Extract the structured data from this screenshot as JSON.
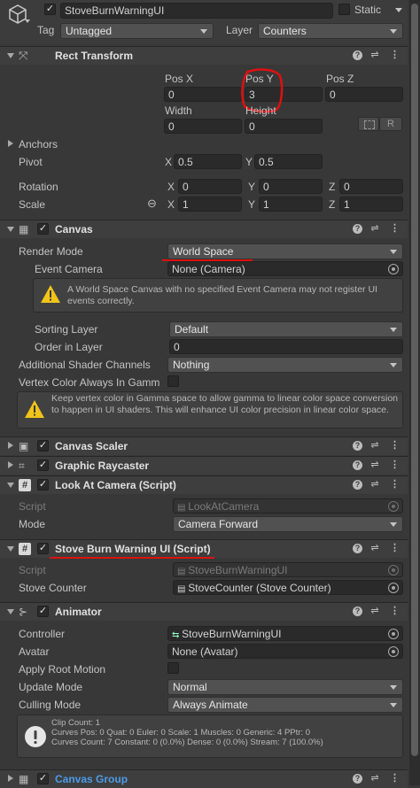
{
  "gameobject": {
    "name": "StoveBurnWarningUI",
    "static_label": "Static",
    "tag_label": "Tag",
    "tag_value": "Untagged",
    "layer_label": "Layer",
    "layer_value": "Counters"
  },
  "rect_transform": {
    "title": "Rect Transform",
    "pos_x_label": "Pos X",
    "pos_x": "0",
    "pos_y_label": "Pos Y",
    "pos_y": "3",
    "pos_z_label": "Pos Z",
    "pos_z": "0",
    "width_label": "Width",
    "width": "0",
    "height_label": "Height",
    "height": "0",
    "r_button": "R",
    "anchors_label": "Anchors",
    "pivot_label": "Pivot",
    "pivot_x": "0.5",
    "pivot_y": "0.5",
    "rotation_label": "Rotation",
    "rot_x": "0",
    "rot_y": "0",
    "rot_z": "0",
    "scale_label": "Scale",
    "scale_x": "1",
    "scale_y": "1",
    "scale_z": "1",
    "x": "X",
    "y": "Y",
    "z": "Z"
  },
  "canvas": {
    "title": "Canvas",
    "render_mode_label": "Render Mode",
    "render_mode": "World Space",
    "event_camera_label": "Event Camera",
    "event_camera": "None (Camera)",
    "warning_text": "A World Space Canvas with no specified Event Camera may not register UI events correctly.",
    "sorting_layer_label": "Sorting Layer",
    "sorting_layer": "Default",
    "order_label": "Order in Layer",
    "order": "0",
    "shader_channels_label": "Additional Shader Channels",
    "shader_channels": "Nothing",
    "vertex_color_label": "Vertex Color Always In Gamm",
    "vertex_warning": "Keep vertex color in Gamma space to allow gamma to linear color space conversion to happen in UI shaders. This will enhance UI color precision in linear color space."
  },
  "canvas_scaler": {
    "title": "Canvas Scaler"
  },
  "graphic_raycaster": {
    "title": "Graphic Raycaster"
  },
  "look_at_camera": {
    "title": "Look At Camera (Script)",
    "script_label": "Script",
    "script": "LookAtCamera",
    "mode_label": "Mode",
    "mode": "Camera Forward"
  },
  "stove_warning": {
    "title": "Stove Burn Warning UI (Script)",
    "script_label": "Script",
    "script": "StoveBurnWarningUI",
    "counter_label": "Stove Counter",
    "counter": "StoveCounter (Stove Counter)"
  },
  "animator": {
    "title": "Animator",
    "controller_label": "Controller",
    "controller": "StoveBurnWarningUI",
    "avatar_label": "Avatar",
    "avatar": "None (Avatar)",
    "root_motion_label": "Apply Root Motion",
    "update_mode_label": "Update Mode",
    "update_mode": "Normal",
    "culling_label": "Culling Mode",
    "culling": "Always Animate",
    "info_line1": "Clip Count: 1",
    "info_line2": "Curves Pos: 0 Quat: 0 Euler: 0 Scale: 1 Muscles: 0 Generic: 4 PPtr: 0",
    "info_line3": "Curves Count: 7 Constant: 0 (0.0%) Dense: 0 (0.0%) Stream: 7 (100.0%)"
  },
  "canvas_group": {
    "title": "Canvas Group"
  },
  "colors": {
    "annotation": "#e01010",
    "link": "#4c9be8"
  }
}
